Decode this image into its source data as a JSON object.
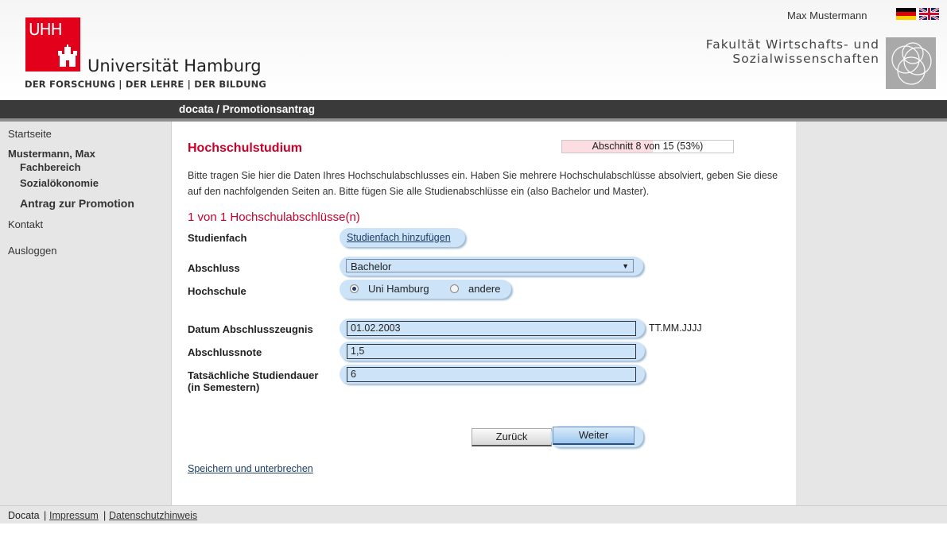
{
  "header": {
    "logo_letters": "UHH",
    "university": "Universität Hamburg",
    "claim": "DER FORSCHUNG | DER LEHRE | DER BILDUNG",
    "user": "Max Mustermann",
    "faculty_line1": "Fakultät Wirtschafts- und",
    "faculty_line2": "Sozialwissenschaften",
    "languages": [
      "de-flag-icon",
      "en-flag-icon"
    ]
  },
  "titlebar": "docata / Promotionsantrag",
  "sidebar": {
    "home": "Startseite",
    "person": "Mustermann, Max",
    "department_label": "Fachbereich",
    "department_value": "Sozialökonomie",
    "application": "Antrag zur Promotion",
    "contact": "Kontakt",
    "logout": "Ausloggen"
  },
  "main": {
    "title": "Hochschulstudium",
    "progress": {
      "text": "Abschnitt 8 von 15 (53%)",
      "fraction": 0.53
    },
    "intro": "Bitte tragen Sie hier die Daten Ihres Hochschulabschlusses ein. Haben Sie mehrere Hochschulabschlüsse absolviert, geben Sie diese auf den nachfolgenden Seiten an. Bitte fügen Sie alle Studienabschlüsse ein (also Bachelor und Master).",
    "count_heading": "1 von 1 Hochschulabschlüsse(n)",
    "labels": {
      "subject": "Studienfach",
      "degree": "Abschluss",
      "university": "Hochschule",
      "date": "Datum Abschlusszeugnis",
      "grade": "Abschlussnote",
      "duration_line1": "Tatsächliche Studiendauer",
      "duration_line2": "(in Semestern)"
    },
    "add_subject_link": "Studienfach hinzufügen",
    "degree_selected": "Bachelor",
    "university_options": [
      {
        "label": "Uni Hamburg",
        "checked": true
      },
      {
        "label": "andere",
        "checked": false
      }
    ],
    "date_value": "01.02.2003",
    "date_hint": "TT.MM.JJJJ",
    "grade_value": "1,5",
    "duration_value": "6",
    "back_button": "Zurück",
    "next_button": "Weiter",
    "save_link": "Speichern und unterbrechen"
  },
  "footer": {
    "app": "Docata",
    "sep": "|",
    "imprint": "Impressum",
    "privacy": "Datenschutzhinweis"
  }
}
